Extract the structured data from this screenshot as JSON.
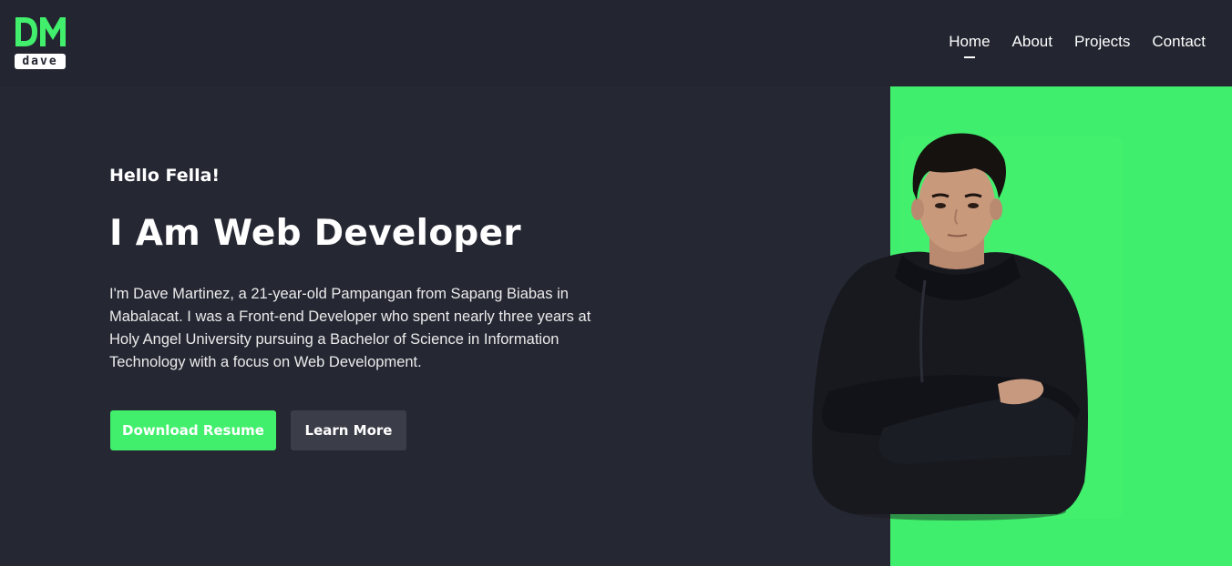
{
  "logo": {
    "monogram": "DM",
    "wordmark": "dave"
  },
  "nav": {
    "items": [
      {
        "label": "Home",
        "active": true
      },
      {
        "label": "About",
        "active": false
      },
      {
        "label": "Projects",
        "active": false
      },
      {
        "label": "Contact",
        "active": false
      }
    ]
  },
  "hero": {
    "greeting": "Hello Fella!",
    "title": "I Am Web Developer",
    "bio": "I'm Dave Martinez, a 21-year-old Pampangan from Sapang Biabas in Mabalacat. I was a Front-end Developer who spent nearly three years at Holy Angel University pursuing a Bachelor of Science in Information Technology with a focus on Web Development.",
    "primary_button": "Download Resume",
    "secondary_button": "Learn More"
  },
  "colors": {
    "background": "#252733",
    "navbar": "#232530",
    "accent": "#41ef6c",
    "secondary_button": "#3b3d48"
  },
  "icons": {
    "logo": "dm-monogram-logo-icon",
    "portrait": "person-portrait-icon"
  }
}
